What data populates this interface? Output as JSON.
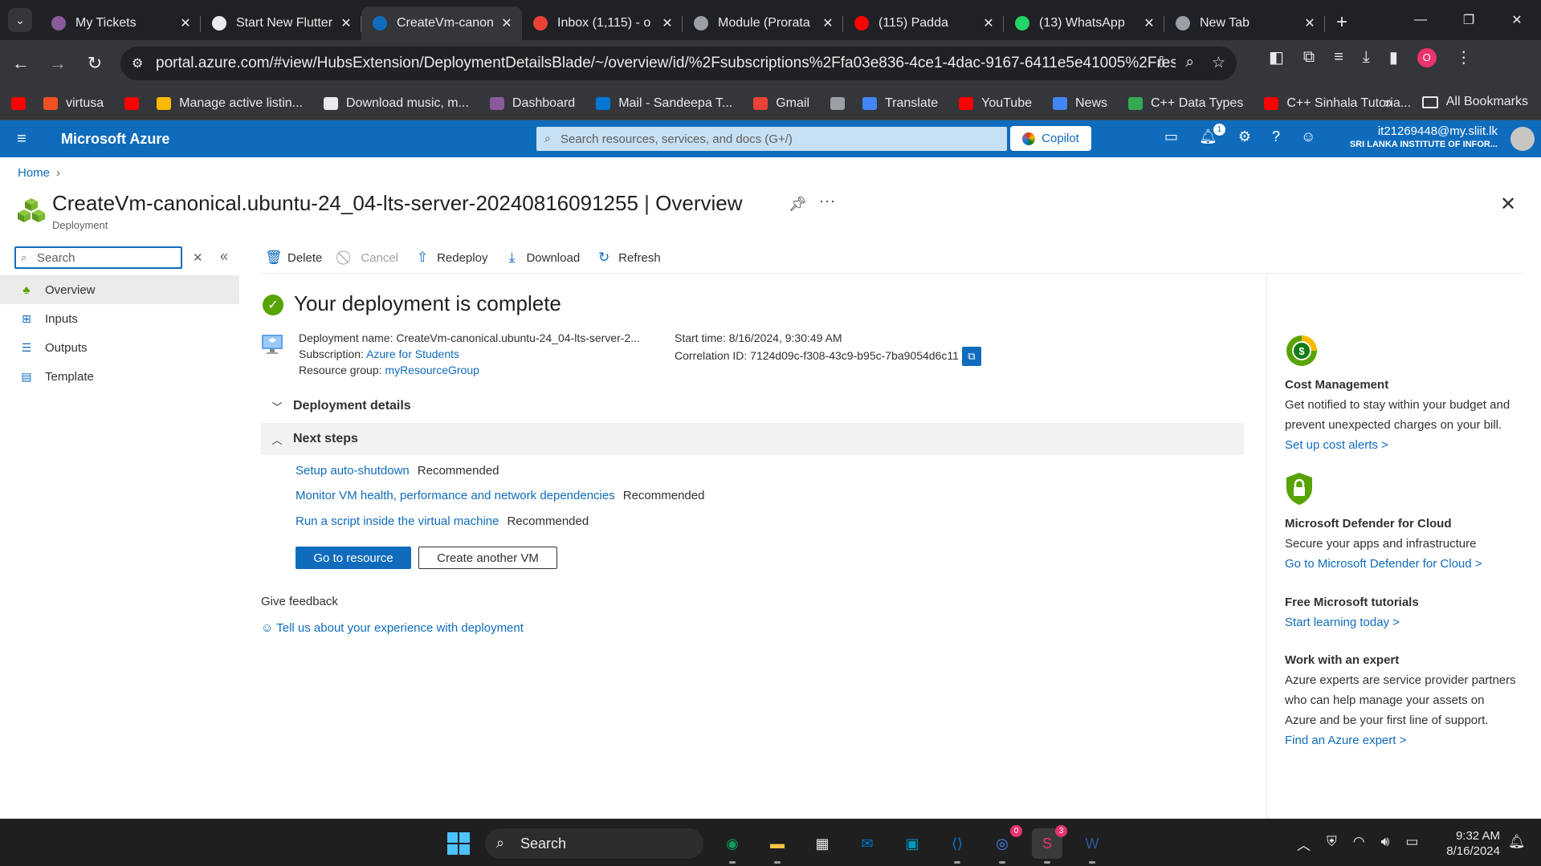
{
  "browser": {
    "tabs": [
      {
        "label": "My Tickets",
        "favicon_color": "#8a5a9a",
        "active": false
      },
      {
        "label": "Start New Flutter",
        "favicon_color": "#e8eaed",
        "active": false
      },
      {
        "label": "CreateVm-canon",
        "favicon_color": "#0f6cbd",
        "active": true
      },
      {
        "label": "Inbox (1,115) - o",
        "favicon_color": "#ea4335",
        "active": false
      },
      {
        "label": "Module (Prorata",
        "favicon_color": "#9aa0a6",
        "active": false
      },
      {
        "label": "(115) Padda",
        "favicon_color": "#ff0000",
        "active": false
      },
      {
        "label": "(13) WhatsApp",
        "favicon_color": "#25d366",
        "active": false
      },
      {
        "label": "New Tab",
        "favicon_color": "#9aa0a6",
        "active": false
      }
    ],
    "url": "portal.azure.com/#view/HubsExtension/DeploymentDetailsBlade/~/overview/id/%2Fsubscriptions%2Ffa03e836-4ce1-4dac-9167-6411e5e41005%2FresourceGr...",
    "profile_initial": "O",
    "bookmarks": [
      {
        "label": "",
        "color": "#ff0000"
      },
      {
        "label": "virtusa",
        "color": "#f25022"
      },
      {
        "label": "",
        "color": "#ff0000"
      },
      {
        "label": "Manage active listin...",
        "color": "#ffb900"
      },
      {
        "label": "Download music, m...",
        "color": "#e8eaed"
      },
      {
        "label": "Dashboard",
        "color": "#8a5a9a"
      },
      {
        "label": "Mail - Sandeepa T...",
        "color": "#0078d4"
      },
      {
        "label": "Gmail",
        "color": "#ea4335"
      },
      {
        "label": "",
        "color": "#9aa0a6"
      },
      {
        "label": "Translate",
        "color": "#4285f4"
      },
      {
        "label": "YouTube",
        "color": "#ff0000"
      },
      {
        "label": "News",
        "color": "#4285f4"
      },
      {
        "label": "C++ Data Types",
        "color": "#34a853"
      },
      {
        "label": "C++ Sinhala Tutoria...",
        "color": "#ff0000"
      }
    ],
    "all_bookmarks": "All Bookmarks"
  },
  "azure": {
    "brand": "Microsoft Azure",
    "search_placeholder": "Search resources, services, and docs (G+/)",
    "copilot": "Copilot",
    "notification_count": "1",
    "user_email": "it21269448@my.sliit.lk",
    "user_org": "SRI LANKA INSTITUTE OF INFOR..."
  },
  "page": {
    "breadcrumb": "Home",
    "title": "CreateVm-canonical.ubuntu-24_04-lts-server-20240816091255",
    "title_suffix": "Overview",
    "subtitle": "Deployment",
    "side_search_placeholder": "Search",
    "nav": [
      {
        "label": "Overview",
        "icon": "deployment-icon"
      },
      {
        "label": "Inputs",
        "icon": "inputs-icon"
      },
      {
        "label": "Outputs",
        "icon": "outputs-icon"
      },
      {
        "label": "Template",
        "icon": "template-icon"
      }
    ],
    "commands": {
      "delete": "Delete",
      "cancel": "Cancel",
      "redeploy": "Redeploy",
      "download": "Download",
      "refresh": "Refresh"
    },
    "status_title": "Your deployment is complete",
    "info": {
      "deployment_name_label": "Deployment name:",
      "deployment_name": "CreateVm-canonical.ubuntu-24_04-lts-server-2...",
      "subscription_label": "Subscription:",
      "subscription": "Azure for Students",
      "resource_group_label": "Resource group:",
      "resource_group": "myResourceGroup",
      "start_time_label": "Start time:",
      "start_time": "8/16/2024, 9:30:49 AM",
      "correlation_label": "Correlation ID:",
      "correlation_id": "7124d09c-f308-43c9-b95c-7ba9054d6c11"
    },
    "deployment_details": "Deployment details",
    "next_steps": "Next steps",
    "steps": [
      {
        "link": "Setup auto-shutdown",
        "tag": "Recommended"
      },
      {
        "link": "Monitor VM health, performance and network dependencies",
        "tag": "Recommended"
      },
      {
        "link": "Run a script inside the virtual machine",
        "tag": "Recommended"
      }
    ],
    "go_to_resource": "Go to resource",
    "create_another": "Create another VM",
    "feedback_title": "Give feedback",
    "feedback_link": "Tell us about your experience with deployment"
  },
  "right_panel": {
    "cost": {
      "title": "Cost Management",
      "desc": "Get notified to stay within your budget and prevent unexpected charges on your bill.",
      "link": "Set up cost alerts >"
    },
    "defender": {
      "title": "Microsoft Defender for Cloud",
      "desc": "Secure your apps and infrastructure",
      "link": "Go to Microsoft Defender for Cloud >"
    },
    "tutorials": {
      "title": "Free Microsoft tutorials",
      "link": "Start learning today >"
    },
    "expert": {
      "title": "Work with an expert",
      "desc": "Azure experts are service provider partners who can help manage your assets on Azure and be your first line of support.",
      "link": "Find an Azure expert >"
    }
  },
  "taskbar": {
    "search": "Search",
    "apps": [
      {
        "name": "edge-icon",
        "color": "#0f9d58"
      },
      {
        "name": "file-explorer-icon",
        "color": "#f5c542"
      },
      {
        "name": "store-icon",
        "color": "#e8eaed"
      },
      {
        "name": "mail-icon",
        "color": "#0078d4"
      },
      {
        "name": "remote-desktop-icon",
        "color": "#0099bc"
      },
      {
        "name": "vscode-icon",
        "color": "#0078d4"
      },
      {
        "name": "chrome-icon",
        "color": "#4285f4",
        "badge": "0"
      },
      {
        "name": "skype-icon",
        "color": "#e8336d",
        "badge": "3"
      },
      {
        "name": "word-icon",
        "color": "#2b579a"
      }
    ],
    "time": "9:32 AM",
    "date": "8/16/2024"
  }
}
